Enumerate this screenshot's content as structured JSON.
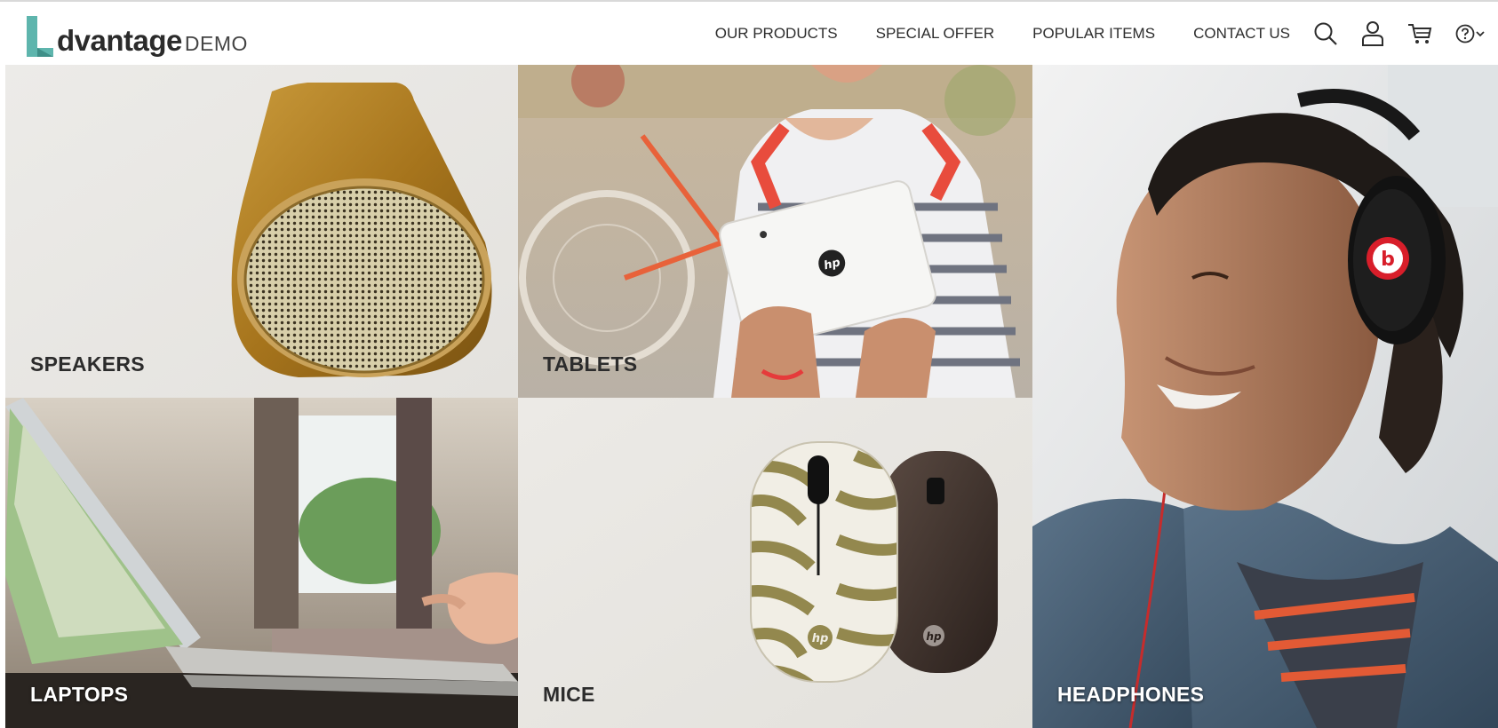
{
  "brand": {
    "name": "dvantage",
    "suffix": "DEMO",
    "accent_color": "#5eb5ad"
  },
  "nav": {
    "links": [
      "OUR PRODUCTS",
      "SPECIAL OFFER",
      "POPULAR ITEMS",
      "CONTACT US"
    ],
    "icons": [
      "search-icon",
      "user-icon",
      "cart-icon",
      "help-icon",
      "chevron-down-icon"
    ]
  },
  "categories": {
    "speakers": "SPEAKERS",
    "tablets": "TABLETS",
    "laptops": "LAPTOPS",
    "mice": "MICE",
    "headphones": "HEADPHONES"
  },
  "product_logos": {
    "hp": "hp",
    "beats": "b"
  }
}
